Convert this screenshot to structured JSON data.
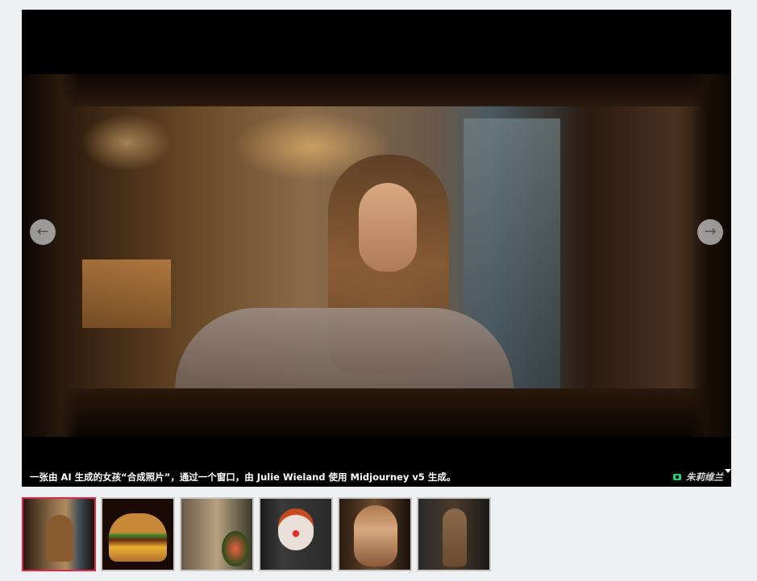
{
  "viewer": {
    "caption": "一张由 AI 生成的女孩“合成照片”，通过一个窗口，由 Julie Wieland 使用 Midjourney v5 生成。",
    "credit": "朱莉维兰",
    "prev_icon": "arrow-left-icon",
    "next_icon": "arrow-right-icon",
    "prev_glyph": "←",
    "next_glyph": "→"
  },
  "thumbnails": [
    {
      "subject": "girl-window",
      "active": true
    },
    {
      "subject": "burger",
      "active": false
    },
    {
      "subject": "man-flowers",
      "active": false
    },
    {
      "subject": "clown",
      "active": false
    },
    {
      "subject": "girl-portrait",
      "active": false
    },
    {
      "subject": "warrior",
      "active": false
    }
  ],
  "colors": {
    "active_border": "#e0284a",
    "credit_icon": "#2ecc71"
  }
}
